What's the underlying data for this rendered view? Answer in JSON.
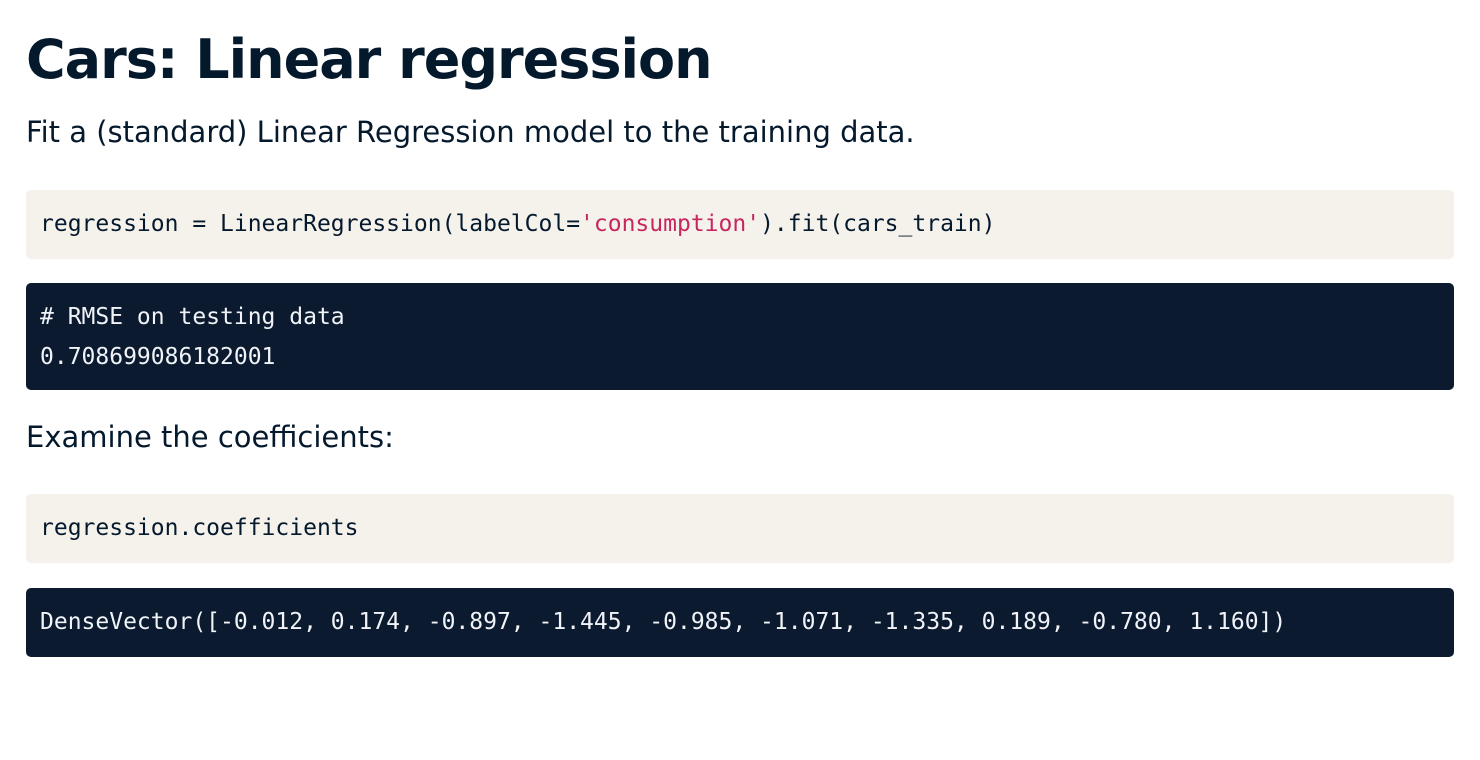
{
  "title": "Cars: Linear regression",
  "intro": "Fit a (standard) Linear Regression model to the training data.",
  "code_fit": {
    "before": "regression = LinearRegression(labelCol=",
    "string": "'consumption'",
    "after": ").fit(cars_train)"
  },
  "output_rmse": {
    "comment": "# RMSE on testing data",
    "value": "0.708699086182001"
  },
  "examine_text": "Examine the coefficients:",
  "code_coefficients": "regression.coefficients",
  "output_coefficients": "DenseVector([-0.012, 0.174, -0.897, -1.445, -0.985, -1.071, -1.335, 0.189, -0.780, 1.160])",
  "colors": {
    "text": "#05192d",
    "code_light_bg": "#f5f2ec",
    "code_dark_bg": "#0b1a2f",
    "string": "#c7265f"
  }
}
